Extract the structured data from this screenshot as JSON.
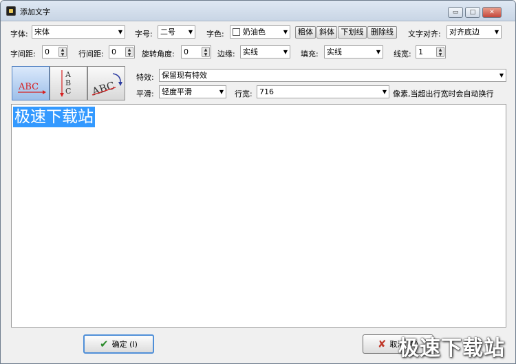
{
  "window": {
    "title": "添加文字",
    "min_glyph": "▭",
    "max_glyph": "□",
    "close_glyph": "✕"
  },
  "row1": {
    "font_label": "字体:",
    "font_value": "宋体",
    "size_label": "字号:",
    "size_value": "二号",
    "color_label": "字色:",
    "color_value": "奶油色",
    "color_hex": "#ffffff",
    "bold": "粗体",
    "italic": "斜体",
    "underline": "下划线",
    "strike": "删除线",
    "align_label": "文字对齐:",
    "align_value": "对齐底边"
  },
  "row2": {
    "char_spacing_label": "字间距:",
    "char_spacing_value": "0",
    "line_spacing_label": "行间距:",
    "line_spacing_value": "0",
    "rotation_label": "旋转角度:",
    "rotation_value": "0",
    "border_label": "边缘:",
    "border_value": "实线",
    "fill_label": "填充:",
    "fill_value": "实线",
    "line_width_label": "线宽:",
    "line_width_value": "1"
  },
  "orientation": {
    "horizontal": "ABC",
    "vertical_a": "A",
    "vertical_b": "B",
    "vertical_c": "C",
    "curved": "ABC"
  },
  "effect": {
    "label": "特效:",
    "value": "保留现有特效"
  },
  "smooth": {
    "label": "平滑:",
    "value": "轻度平滑"
  },
  "width": {
    "label": "行宽:",
    "value": "716",
    "hint": "像素,当超出行宽时会自动换行"
  },
  "editor": {
    "text": "极速下载站"
  },
  "buttons": {
    "ok": "确定 (I)",
    "ok_icon": "✔",
    "cancel": "取消 (C)",
    "cancel_icon": "✘"
  },
  "watermark": "极速下载站",
  "colors": {
    "accent": "#3399ff",
    "ok_icon": "#2a8a2a",
    "cancel_icon": "#c0392b"
  }
}
